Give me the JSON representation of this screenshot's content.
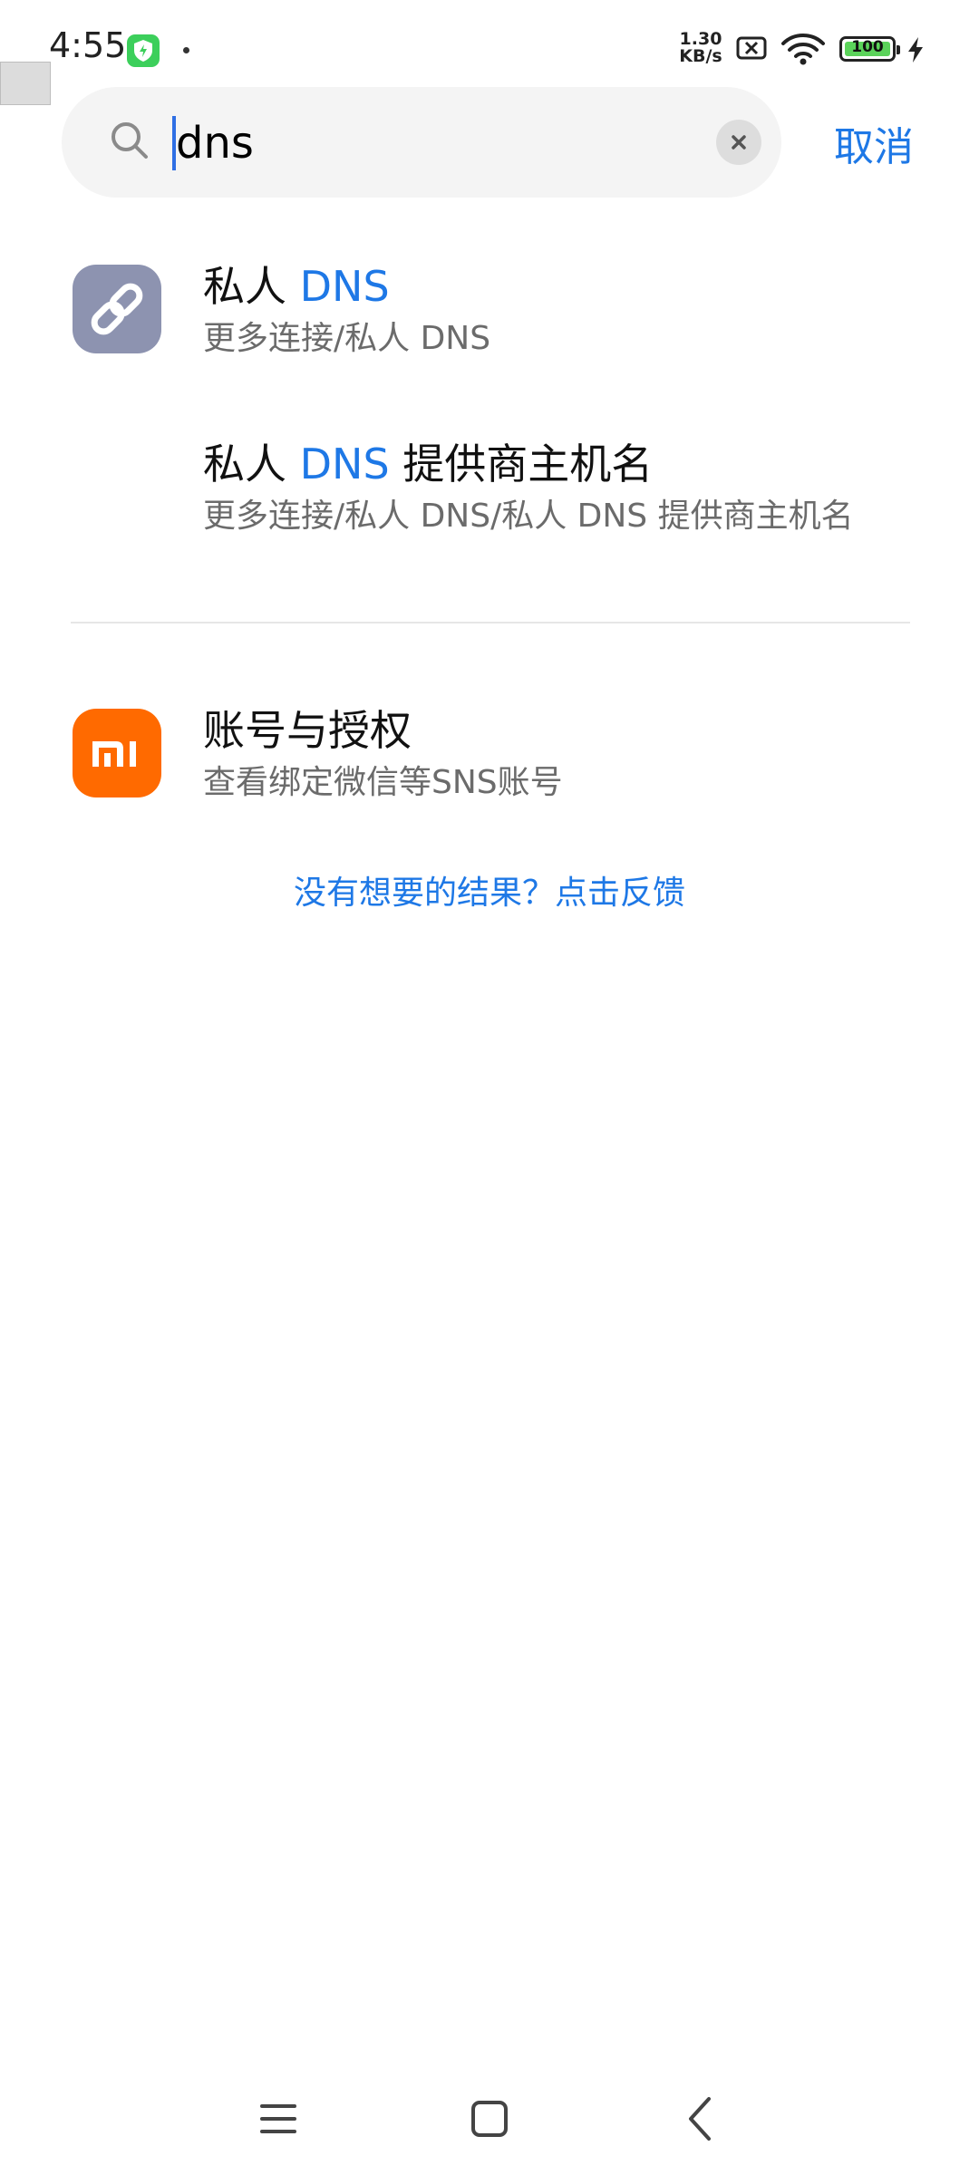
{
  "status_bar": {
    "time": "4:55",
    "net_speed_value": "1.30",
    "net_speed_unit": "KB/s",
    "battery_level": "100",
    "accent_green": "#3ccf5b"
  },
  "search": {
    "query": "dns",
    "clear_icon": "close-icon",
    "cancel_label": "取消",
    "accent": "#1e78e6"
  },
  "results": [
    {
      "icon": "link-icon",
      "title_prefix": "私人 ",
      "title_highlight": "DNS",
      "title_suffix": "",
      "subtitle": "更多连接/私人 DNS"
    },
    {
      "title_prefix": "私人 ",
      "title_highlight": "DNS",
      "title_suffix": " 提供商主机名",
      "subtitle": "更多连接/私人 DNS/私人 DNS 提供商主机名"
    },
    {
      "icon": "mi-logo-icon",
      "title": "账号与授权",
      "subtitle": "查看绑定微信等SNS账号"
    }
  ],
  "feedback_link": "没有想要的结果？点击反馈",
  "nav": {
    "menu_icon": "menu-icon",
    "home_icon": "home-icon",
    "back_icon": "back-icon"
  }
}
